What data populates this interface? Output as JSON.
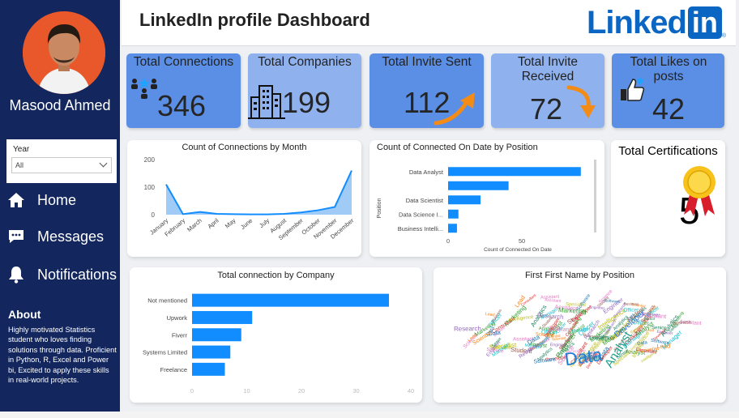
{
  "sidebar": {
    "name": "Masood Ahmed",
    "year_filter": {
      "label": "Year",
      "value": "All"
    },
    "nav": [
      {
        "icon": "home-icon",
        "label": "Home"
      },
      {
        "icon": "messages-icon",
        "label": "Messages"
      },
      {
        "icon": "notifications-icon",
        "label": "Notifications"
      }
    ],
    "about": {
      "title": "About",
      "text": "Highly motivated Statistics student who loves finding solutions through data. Proficient in Python, R, Excel and Power bi, Excited to apply these skills in real-world projects."
    }
  },
  "header": {
    "title": "LinkedIn profile Dashboard",
    "logo_text": "Linked",
    "logo_box": "in",
    "logo_reg": "®"
  },
  "kpis": [
    {
      "title": "Total Connections",
      "value": "346",
      "color": "#5b8fe6"
    },
    {
      "title": "Total Companies",
      "value": "199",
      "color": "#8fb2ef"
    },
    {
      "title": "Total Invite Sent",
      "value": "112",
      "color": "#5b8fe6"
    },
    {
      "title": "Total Invite Received",
      "value": "72",
      "color": "#8fb2ef"
    },
    {
      "title": "Total Likes on posts",
      "value": "42",
      "color": "#5b8fe6"
    }
  ],
  "certifications": {
    "title": "Total Certifications",
    "value": "5"
  },
  "colors": {
    "accent": "#118dff",
    "sidebar": "#13275e",
    "area_fill": "#8fc2f5"
  },
  "chart_data": [
    {
      "type": "area",
      "title": "Count of Connections by Month",
      "categories": [
        "January",
        "February",
        "March",
        "April",
        "May",
        "June",
        "July",
        "August",
        "September",
        "October",
        "November",
        "December"
      ],
      "values": [
        110,
        2,
        10,
        3,
        2,
        1,
        1,
        3,
        8,
        16,
        28,
        160
      ],
      "ylim": [
        0,
        200
      ],
      "yticks": [
        "0",
        "100",
        "200"
      ]
    },
    {
      "type": "bar",
      "title": "Count of Connected On Date by Position",
      "ylabel": "Position",
      "xlabel": "Count of Connected On Date",
      "categories": [
        "Data Analyst",
        "",
        "Data Scientist",
        "Data Science I...",
        "Business Intelli..."
      ],
      "values": [
        90,
        41,
        22,
        7,
        6
      ],
      "xticks": [
        "0",
        "50"
      ],
      "xlim": [
        0,
        100
      ]
    },
    {
      "type": "bar",
      "title": "Total connection by Company",
      "categories": [
        "Not mentioned",
        "Upwork",
        "Fiverr",
        "Systems Limited",
        "Freelance"
      ],
      "values": [
        36,
        11,
        9,
        7,
        6
      ],
      "xticks": [
        "0",
        "10",
        "20",
        "30",
        "40"
      ],
      "xlim": [
        0,
        40
      ]
    }
  ],
  "wordcloud": {
    "title": "First First Name by Position",
    "words": [
      "Data",
      "Analyst",
      "Developer",
      "Engineer",
      "Business",
      "Science",
      "Manager",
      "Intelligence",
      "Scientist",
      "Analytics",
      "Software",
      "Marketing",
      "Consultant",
      "Research",
      "Student",
      "Assistant",
      "Officer",
      "Specialist",
      "Lead",
      "Senior"
    ]
  }
}
